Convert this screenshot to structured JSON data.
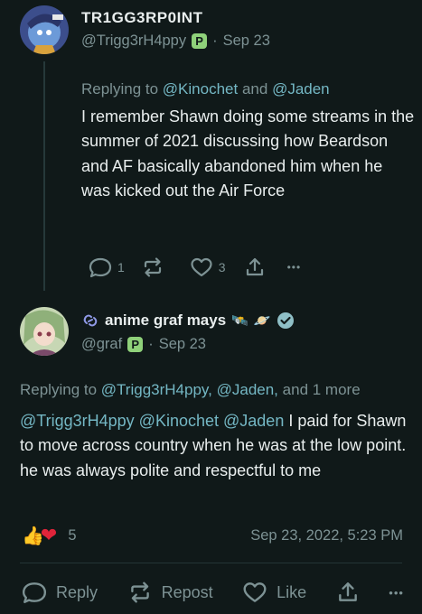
{
  "post1": {
    "display_name": "TR1GG3RP0INT",
    "handle": "@Trigg3rH4ppy",
    "badge": "P",
    "separator": "·",
    "date": "Sep 23",
    "replying_prefix": "Replying to",
    "replying_user1": "@Kinochet",
    "replying_and": "and",
    "replying_user2": "@Jaden",
    "body": "I remember Shawn doing some streams in the summer of 2021 discussing how Beardson and AF basically abandoned him when he was kicked out the Air Force",
    "reply_count": "1",
    "like_count": "3",
    "more_glyph": "•••"
  },
  "post2": {
    "display_name": "anime graf mays",
    "handle": "@graf",
    "badge": "P",
    "separator": "·",
    "date": "Sep 23",
    "emoji1": "🛰️",
    "emoji2": "🪐",
    "replying_prefix": "Replying to",
    "replying_user1": "@Trigg3rH4ppy,",
    "replying_user2": "@Jaden,",
    "replying_more": "and 1 more",
    "mention1": "@Trigg3rH4ppy",
    "mention2": "@Kinochet",
    "mention3": "@Jaden",
    "body": " I paid for Shawn to move across country when he was at the low point. he was always polite and respectful to me",
    "reaction_emoji1": "👍",
    "reaction_emoji2": "❤",
    "reaction_count": "5",
    "timestamp": "Sep 23, 2022, 5:23 PM",
    "reply_label": "Reply",
    "repost_label": "Repost",
    "like_label": "Like",
    "more_glyph": "•••"
  },
  "colors": {
    "background": "#101919",
    "accent": "#74b7c4",
    "muted": "#7d9294",
    "badge_green": "#8fd17a",
    "verified": "#8fbfc6"
  }
}
